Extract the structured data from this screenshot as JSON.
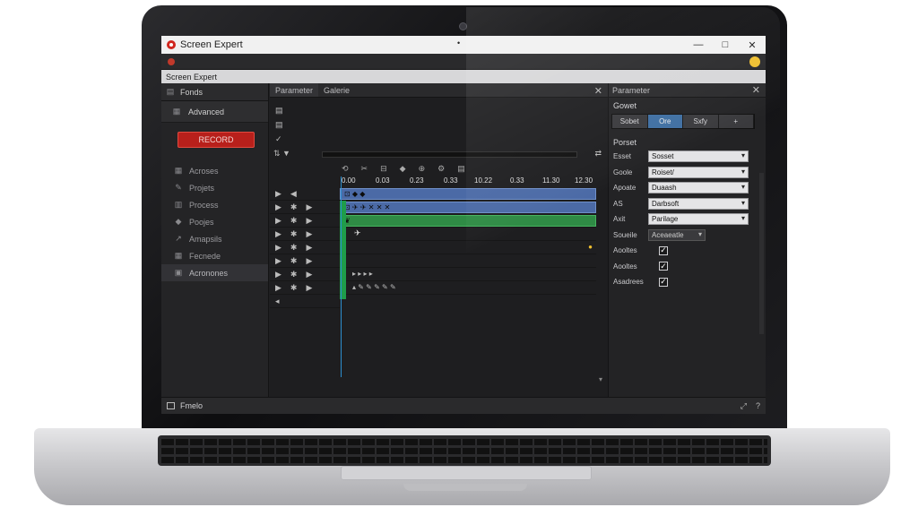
{
  "window": {
    "title": "Screen Expert",
    "center_mark": "•",
    "min": "—",
    "max": "□",
    "close": "✕"
  },
  "subbar": {
    "title": "Screen Expert"
  },
  "sidebar": {
    "header": "Fonds",
    "subheader": "Advanced",
    "record_button": "RECORD",
    "items": [
      {
        "label": "Acroses",
        "icon": "grid-icon"
      },
      {
        "label": "Projets",
        "icon": "pen-icon"
      },
      {
        "label": "Process",
        "icon": "layers-icon"
      },
      {
        "label": "Poojes",
        "icon": "tag-icon"
      },
      {
        "label": "Amapsils",
        "icon": "arrow-icon"
      },
      {
        "label": "Fecnede",
        "icon": "grid-icon"
      },
      {
        "label": "Acronones",
        "icon": "folder-icon"
      }
    ]
  },
  "center": {
    "tabs": [
      "Parameter",
      "Galerie"
    ],
    "ruler": [
      "0.00",
      "0.03",
      "0.23",
      "0.33",
      "10.22",
      "0.33",
      "11.30",
      "12.30"
    ],
    "clip1_label": "⊡ ◆ ◆",
    "clip2_label": "⊡ ✈ ✈ ✕ ✕ ✕",
    "clip3_label": "❦",
    "marker_row": "▸ ▸ ▸ ▸",
    "tool_row": "▴ ✎ ✎ ✎ ✎ ✎"
  },
  "right": {
    "header": "Parameter",
    "section1": "Gowet",
    "seg": [
      "Sobet",
      "Ore",
      "Sxfy",
      "+"
    ],
    "section2": "Porset",
    "props": [
      {
        "label": "Esset",
        "value": "Sosset"
      },
      {
        "label": "Goole",
        "value": "Roiset/"
      },
      {
        "label": "Apoate",
        "value": "Duaash"
      },
      {
        "label": "AS",
        "value": "Darbsoft"
      },
      {
        "label": "Axit",
        "value": "Parilage"
      },
      {
        "label": "Soueile",
        "value": "Aceaeatle"
      }
    ],
    "checks": [
      {
        "label": "Aooltes",
        "checked": "✓"
      },
      {
        "label": "Aooltes",
        "checked": "✓"
      },
      {
        "label": "Asadrees",
        "checked": "✓"
      }
    ]
  },
  "status": {
    "label": "Fmelo"
  },
  "colors": {
    "record": "#b8201b",
    "accent_blue": "#3f6fa2",
    "track_blue": "#4b6aa6",
    "track_green": "#2f8b45",
    "playhead": "#2c8fd0"
  }
}
